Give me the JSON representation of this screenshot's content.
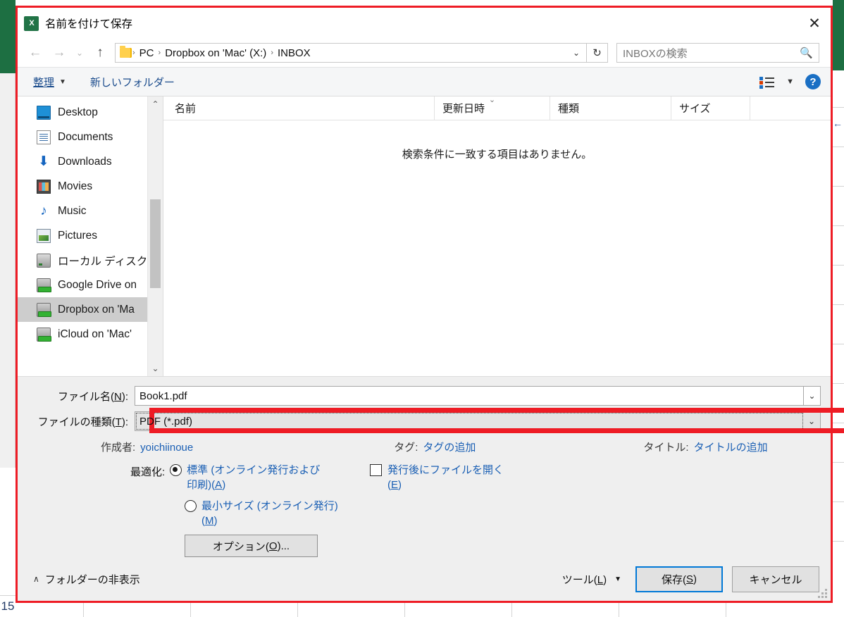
{
  "background": {
    "app": "Excel",
    "row_header": "15",
    "ribbon_color": "#1d6f42"
  },
  "dialog": {
    "title": "名前を付けて保存",
    "app_icon": "excel-icon",
    "close_label": "✕",
    "highlight_color": "#ee1c25"
  },
  "nav": {
    "back": "←",
    "forward": "→",
    "recent": "⌄",
    "up": "↑",
    "breadcrumbs": [
      "PC",
      "Dropbox on 'Mac' (X:)",
      "INBOX"
    ],
    "separator": "›",
    "dropdown": "⌄",
    "refresh": "↻"
  },
  "search": {
    "placeholder": "INBOXの検索",
    "icon": "search-icon"
  },
  "commandbar": {
    "organize": "整理",
    "organize_caret": "▼",
    "new_folder": "新しいフォルダー",
    "view_icon": "view-list-icon",
    "view_caret": "▼",
    "help_icon": "?"
  },
  "sidebar": {
    "items": [
      {
        "label": "Desktop",
        "icon": "desktop-icon",
        "selected": false
      },
      {
        "label": "Documents",
        "icon": "documents-icon",
        "selected": false
      },
      {
        "label": "Downloads",
        "icon": "downloads-icon",
        "selected": false
      },
      {
        "label": "Movies",
        "icon": "movies-icon",
        "selected": false
      },
      {
        "label": "Music",
        "icon": "music-icon",
        "selected": false
      },
      {
        "label": "Pictures",
        "icon": "pictures-icon",
        "selected": false
      },
      {
        "label": "ローカル ディスク (C",
        "icon": "local-disk-icon",
        "selected": false
      },
      {
        "label": "Google Drive on",
        "icon": "network-drive-icon",
        "selected": false
      },
      {
        "label": "Dropbox on 'Ma",
        "icon": "network-drive-icon",
        "selected": true
      },
      {
        "label": "iCloud on 'Mac'",
        "icon": "network-drive-icon",
        "selected": false
      }
    ],
    "scroll_up": "⌃",
    "scroll_down": "⌄"
  },
  "filelist": {
    "columns": [
      "名前",
      "更新日時",
      "種類",
      "サイズ"
    ],
    "sort_indicator": "⌄",
    "empty_message": "検索条件に一致する項目はありません。",
    "rows": []
  },
  "form": {
    "filename_label": "ファイル名(N):",
    "filename_label_plain": "ファイル名(",
    "filename_accel": "N",
    "filename_value": "Book1.pdf",
    "filetype_label_plain": "ファイルの種類(",
    "filetype_accel": "T",
    "filetype_value": "PDF (*.pdf)",
    "combo_chevron": "⌄"
  },
  "metadata": [
    {
      "label": "作成者:",
      "value": "yoichiinoue"
    },
    {
      "label": "タグ:",
      "value": "タグの追加"
    },
    {
      "label": "タイトル:",
      "value": "タイトルの追加"
    }
  ],
  "optimize": {
    "title": "最適化:",
    "options": [
      {
        "label": "標準 (オンライン発行および印刷)(",
        "accel": "A",
        "suffix": ")",
        "selected": true
      },
      {
        "label": "最小サイズ (オンライン発行)(",
        "accel": "M",
        "suffix": ")",
        "selected": false
      }
    ],
    "options_button_plain": "オプション(",
    "options_button_accel": "O",
    "options_button_suffix": ")...",
    "open_after_publish": {
      "label": "発行後にファイルを開く",
      "accel": "E",
      "checked": false
    }
  },
  "footer": {
    "hide_folders_caret": "∧",
    "hide_folders": "フォルダーの非表示",
    "tools_plain": "ツール(",
    "tools_accel": "L",
    "tools_suffix": ")",
    "tools_caret": "▼",
    "save_plain": "保存(",
    "save_accel": "S",
    "save_suffix": ")",
    "cancel": "キャンセル"
  }
}
